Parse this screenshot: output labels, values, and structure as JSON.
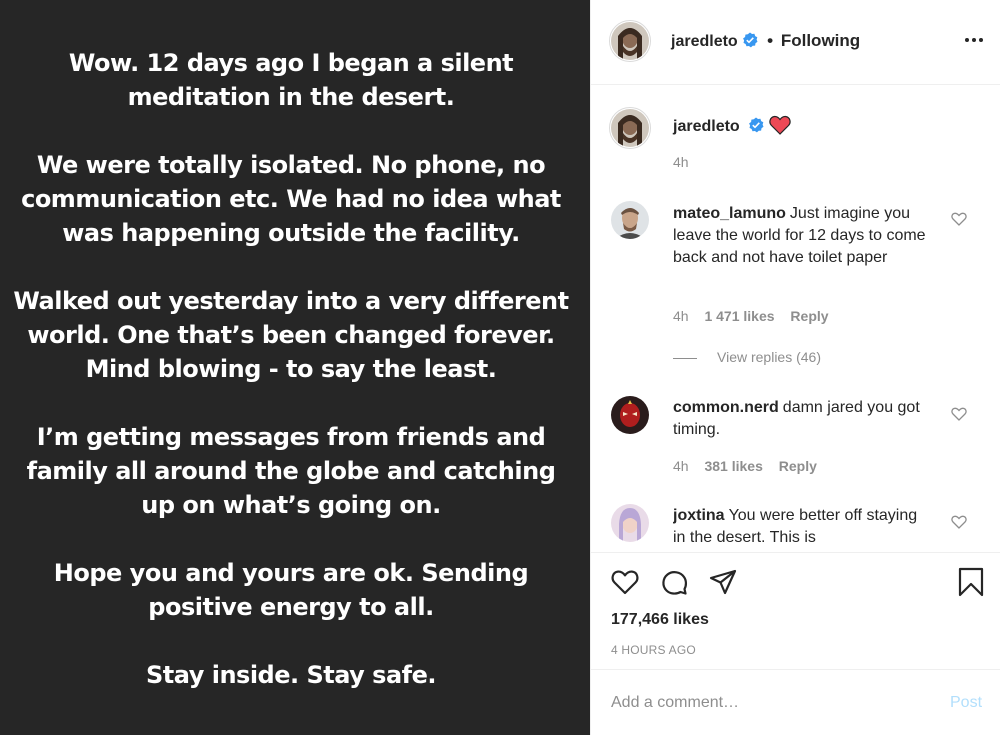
{
  "post": {
    "paragraphs": [
      "Wow. 12 days ago I began a silent\nmeditation in the desert.",
      "We were totally isolated. No phone, no\ncommunication etc. We had no idea what\nwas happening outside the facility.",
      "Walked out yesterday into a very different\nworld. One that’s been changed forever.\nMind blowing - to say the least.",
      "I’m getting messages from friends and\nfamily all around the globe and catching\nup on what’s going on.",
      "Hope you and yours are ok. Sending\npositive energy to all.",
      "Stay inside. Stay safe."
    ]
  },
  "header": {
    "username": "jaredleto",
    "separator": "•",
    "following": "Following",
    "more_icon": "more-horizontal-icon"
  },
  "caption": {
    "username": "jaredleto",
    "time": "4h"
  },
  "comments": [
    {
      "username": "mateo_lamuno",
      "text": "Just imagine you leave the world for 12 days to come back and not have toilet paper",
      "time": "4h",
      "likes": "1 471 likes",
      "reply": "Reply",
      "view_replies": "View replies (46)"
    },
    {
      "username": "common.nerd",
      "text": "damn jared you got timing.",
      "time": "4h",
      "likes": "381 likes",
      "reply": "Reply"
    },
    {
      "username": "joxtina",
      "text": "You were better off staying in the desert. This is"
    }
  ],
  "actions": {
    "likes": "177,466 likes",
    "time_ago": "4 HOURS AGO",
    "icons": [
      "heart-icon",
      "comment-icon",
      "share-icon",
      "bookmark-icon"
    ]
  },
  "comment_box": {
    "placeholder": "Add a comment…",
    "post_label": "Post"
  },
  "colors": {
    "image_bg": "#262626",
    "verified": "#3897f0",
    "red_heart": "#ed4956",
    "muted": "#8e8e8e",
    "post_disabled": "#b2dffc"
  }
}
